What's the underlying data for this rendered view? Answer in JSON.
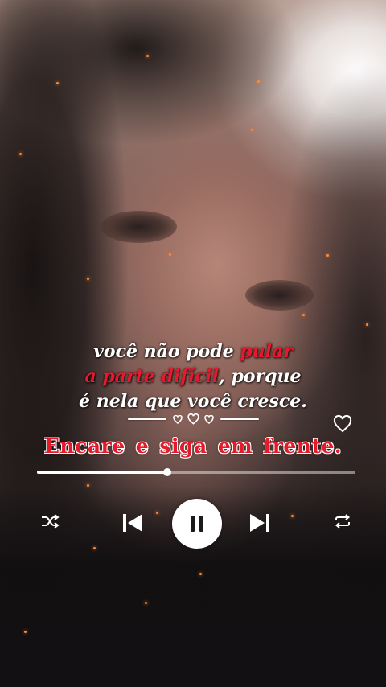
{
  "lyrics": {
    "line1": {
      "pre": "você não pode ",
      "hl": "pular"
    },
    "line2": {
      "hl": "a parte difícil",
      "post": ", porque"
    },
    "line3": "é nela que você cresce."
  },
  "song_title": "Encare e siga em frente.",
  "player": {
    "progress": 0.41,
    "accent_color": "#e31b2b",
    "highlight_color": "#e8182e",
    "state": "playing"
  },
  "icons": {
    "like": "heart-outline-icon",
    "shuffle": "shuffle-icon",
    "previous": "skip-previous-icon",
    "play_pause": "pause-icon",
    "next": "skip-next-icon",
    "repeat": "repeat-icon"
  }
}
